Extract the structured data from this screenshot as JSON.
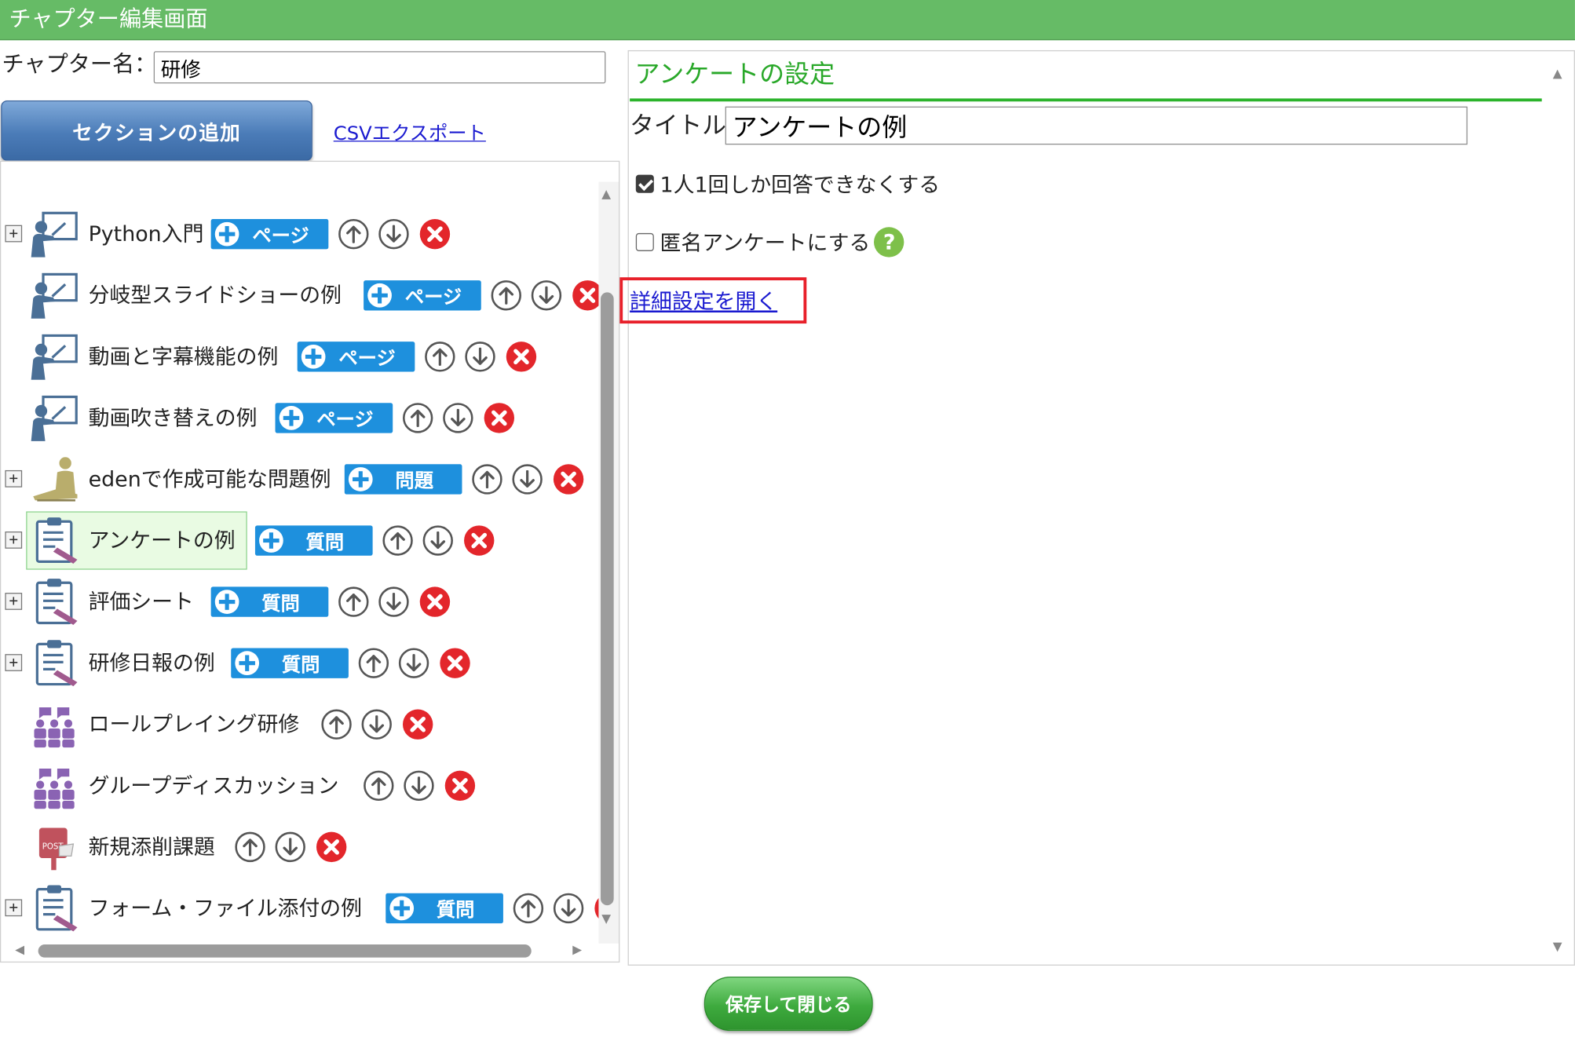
{
  "window": {
    "title": "チャプター編集画面"
  },
  "chapter": {
    "name_label": "チャプター名：",
    "name_value": "研修"
  },
  "toolbar": {
    "add_section_label": "セクションの追加",
    "csv_export_label": "CSVエクスポート"
  },
  "tree": {
    "items": [
      {
        "label": "Python入門",
        "icon": "lecture-icon",
        "add": "ページ",
        "expand": true
      },
      {
        "label": "分岐型スライドショーの例",
        "icon": "lecture-icon",
        "add": "ページ",
        "expand": false
      },
      {
        "label": "動画と字幕機能の例",
        "icon": "lecture-icon",
        "add": "ページ",
        "expand": false
      },
      {
        "label": "動画吹き替えの例",
        "icon": "lecture-icon",
        "add": "ページ",
        "expand": false
      },
      {
        "label": "edenで作成可能な問題例",
        "icon": "exam-icon",
        "add": "問題",
        "expand": true
      },
      {
        "label": "アンケートの例",
        "icon": "survey-icon",
        "add": "質問",
        "expand": true,
        "selected": true
      },
      {
        "label": "評価シート",
        "icon": "survey-icon",
        "add": "質問",
        "expand": true
      },
      {
        "label": "研修日報の例",
        "icon": "survey-icon",
        "add": "質問",
        "expand": true
      },
      {
        "label": "ロールプレイング研修",
        "icon": "group-icon",
        "add": "",
        "expand": false
      },
      {
        "label": "グループディスカッション",
        "icon": "group-icon",
        "add": "",
        "expand": false
      },
      {
        "label": "新規添削課題",
        "icon": "post-icon",
        "add": "",
        "expand": false
      },
      {
        "label": "フォーム・ファイル添付の例",
        "icon": "survey-icon",
        "add": "質問",
        "expand": true
      }
    ]
  },
  "settings": {
    "heading": "アンケートの設定",
    "title_label": "タイトル:",
    "title_value": "アンケートの例",
    "once_only_label": "1人1回しか回答できなくする",
    "once_only_checked": true,
    "anonymous_label": "匿名アンケートにする",
    "anonymous_checked": false,
    "help_glyph": "?",
    "detail_link": "詳細設定を開く"
  },
  "footer": {
    "save_close_label": "保存して閉じる"
  },
  "colors": {
    "header_green": "#66bb66",
    "accent_blue": "#1e90dd",
    "delete_red": "#e3262b",
    "highlight_red": "#e8202a"
  }
}
